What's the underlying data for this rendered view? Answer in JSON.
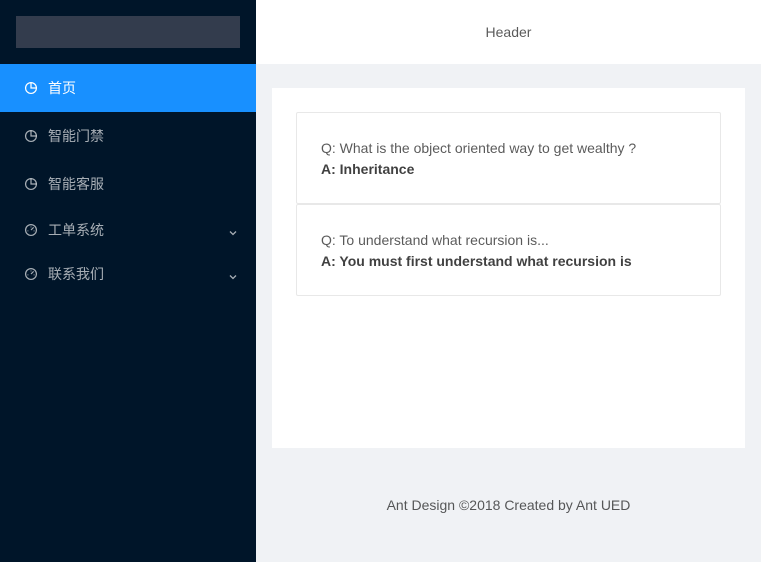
{
  "sidebar": {
    "items": [
      {
        "label": "首页",
        "icon": "pie-chart-icon",
        "selected": true
      },
      {
        "label": "智能门禁",
        "icon": "pie-chart-icon"
      },
      {
        "label": "智能客服",
        "icon": "pie-chart-icon"
      },
      {
        "label": "工单系统",
        "icon": "dashboard-icon",
        "submenu": true
      },
      {
        "label": "联系我们",
        "icon": "dashboard-icon",
        "submenu": true
      }
    ],
    "background": "#001529",
    "selected_color": "#1890ff"
  },
  "header": {
    "title": "Header"
  },
  "content": {
    "qa": [
      {
        "q": "Q: What is the object oriented way to get wealthy ?",
        "a": "A: Inheritance"
      },
      {
        "q": "Q: To understand what recursion is...",
        "a": "A: You must first understand what recursion is"
      }
    ]
  },
  "footer": {
    "text": "Ant Design ©2018 Created by Ant UED"
  }
}
